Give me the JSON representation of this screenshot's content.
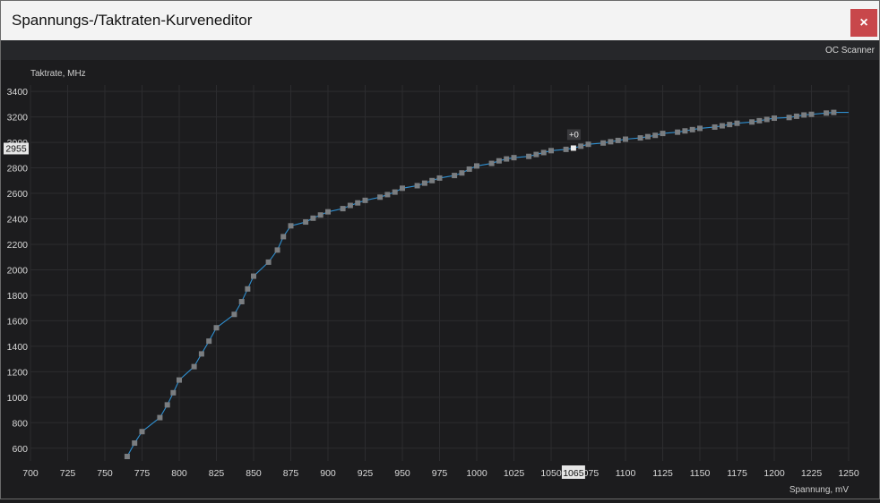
{
  "window": {
    "title": "Spannungs-/Taktraten-Kurveneditor",
    "close_icon": "×"
  },
  "toolbar": {
    "oc_scanner_label": "OC Scanner"
  },
  "colors": {
    "line": "#2f8fd0",
    "point": "#7a7d80",
    "selected_point": "#ececec",
    "grid": "#2c2c2f",
    "close": "#c8474b"
  },
  "chart_data": {
    "type": "line",
    "ylabel": "Taktrate, MHz",
    "xlabel": "Spannung, mV",
    "xlim": [
      700,
      1250
    ],
    "ylim": [
      500,
      3450
    ],
    "x_ticks": [
      700,
      725,
      750,
      775,
      800,
      825,
      850,
      875,
      900,
      925,
      950,
      975,
      1000,
      1025,
      1050,
      1075,
      1100,
      1125,
      1150,
      1175,
      1200,
      1225,
      1250
    ],
    "y_ticks": [
      600,
      800,
      1000,
      1200,
      1400,
      1600,
      1800,
      2000,
      2200,
      2400,
      2600,
      2800,
      3000,
      3200,
      3400
    ],
    "grid": true,
    "selected": {
      "x_label": "1065",
      "y_label": "2955",
      "offset_label": "+0"
    },
    "series": [
      {
        "points": [
          [
            765,
            535
          ],
          [
            770,
            640
          ],
          [
            775,
            730
          ],
          [
            787,
            840
          ],
          [
            792,
            940
          ],
          [
            796,
            1035
          ],
          [
            800,
            1135
          ],
          [
            810,
            1240
          ],
          [
            815,
            1340
          ],
          [
            820,
            1440
          ],
          [
            825,
            1545
          ],
          [
            837,
            1650
          ],
          [
            842,
            1750
          ],
          [
            846,
            1850
          ],
          [
            850,
            1950
          ],
          [
            860,
            2060
          ],
          [
            866,
            2155
          ],
          [
            870,
            2260
          ],
          [
            875,
            2345
          ],
          [
            885,
            2375
          ],
          [
            890,
            2405
          ],
          [
            895,
            2430
          ],
          [
            900,
            2455
          ],
          [
            910,
            2480
          ],
          [
            915,
            2505
          ],
          [
            920,
            2525
          ],
          [
            925,
            2545
          ],
          [
            935,
            2570
          ],
          [
            940,
            2590
          ],
          [
            945,
            2610
          ],
          [
            950,
            2640
          ],
          [
            960,
            2660
          ],
          [
            965,
            2680
          ],
          [
            970,
            2700
          ],
          [
            975,
            2720
          ],
          [
            985,
            2740
          ],
          [
            990,
            2760
          ],
          [
            995,
            2790
          ],
          [
            1000,
            2815
          ],
          [
            1010,
            2835
          ],
          [
            1015,
            2855
          ],
          [
            1020,
            2870
          ],
          [
            1025,
            2880
          ],
          [
            1035,
            2890
          ],
          [
            1040,
            2905
          ],
          [
            1045,
            2920
          ],
          [
            1050,
            2935
          ],
          [
            1060,
            2945
          ],
          [
            1065,
            2955
          ],
          [
            1070,
            2970
          ],
          [
            1075,
            2985
          ],
          [
            1085,
            2995
          ],
          [
            1090,
            3005
          ],
          [
            1095,
            3015
          ],
          [
            1100,
            3025
          ],
          [
            1110,
            3035
          ],
          [
            1115,
            3045
          ],
          [
            1120,
            3055
          ],
          [
            1125,
            3070
          ],
          [
            1135,
            3080
          ],
          [
            1140,
            3090
          ],
          [
            1145,
            3100
          ],
          [
            1150,
            3110
          ],
          [
            1160,
            3120
          ],
          [
            1165,
            3130
          ],
          [
            1170,
            3140
          ],
          [
            1175,
            3150
          ],
          [
            1185,
            3160
          ],
          [
            1190,
            3170
          ],
          [
            1195,
            3180
          ],
          [
            1200,
            3190
          ],
          [
            1210,
            3195
          ],
          [
            1215,
            3205
          ],
          [
            1220,
            3215
          ],
          [
            1225,
            3220
          ],
          [
            1235,
            3230
          ],
          [
            1240,
            3235
          ]
        ],
        "tail_end": [
          1250,
          3235
        ]
      }
    ]
  }
}
